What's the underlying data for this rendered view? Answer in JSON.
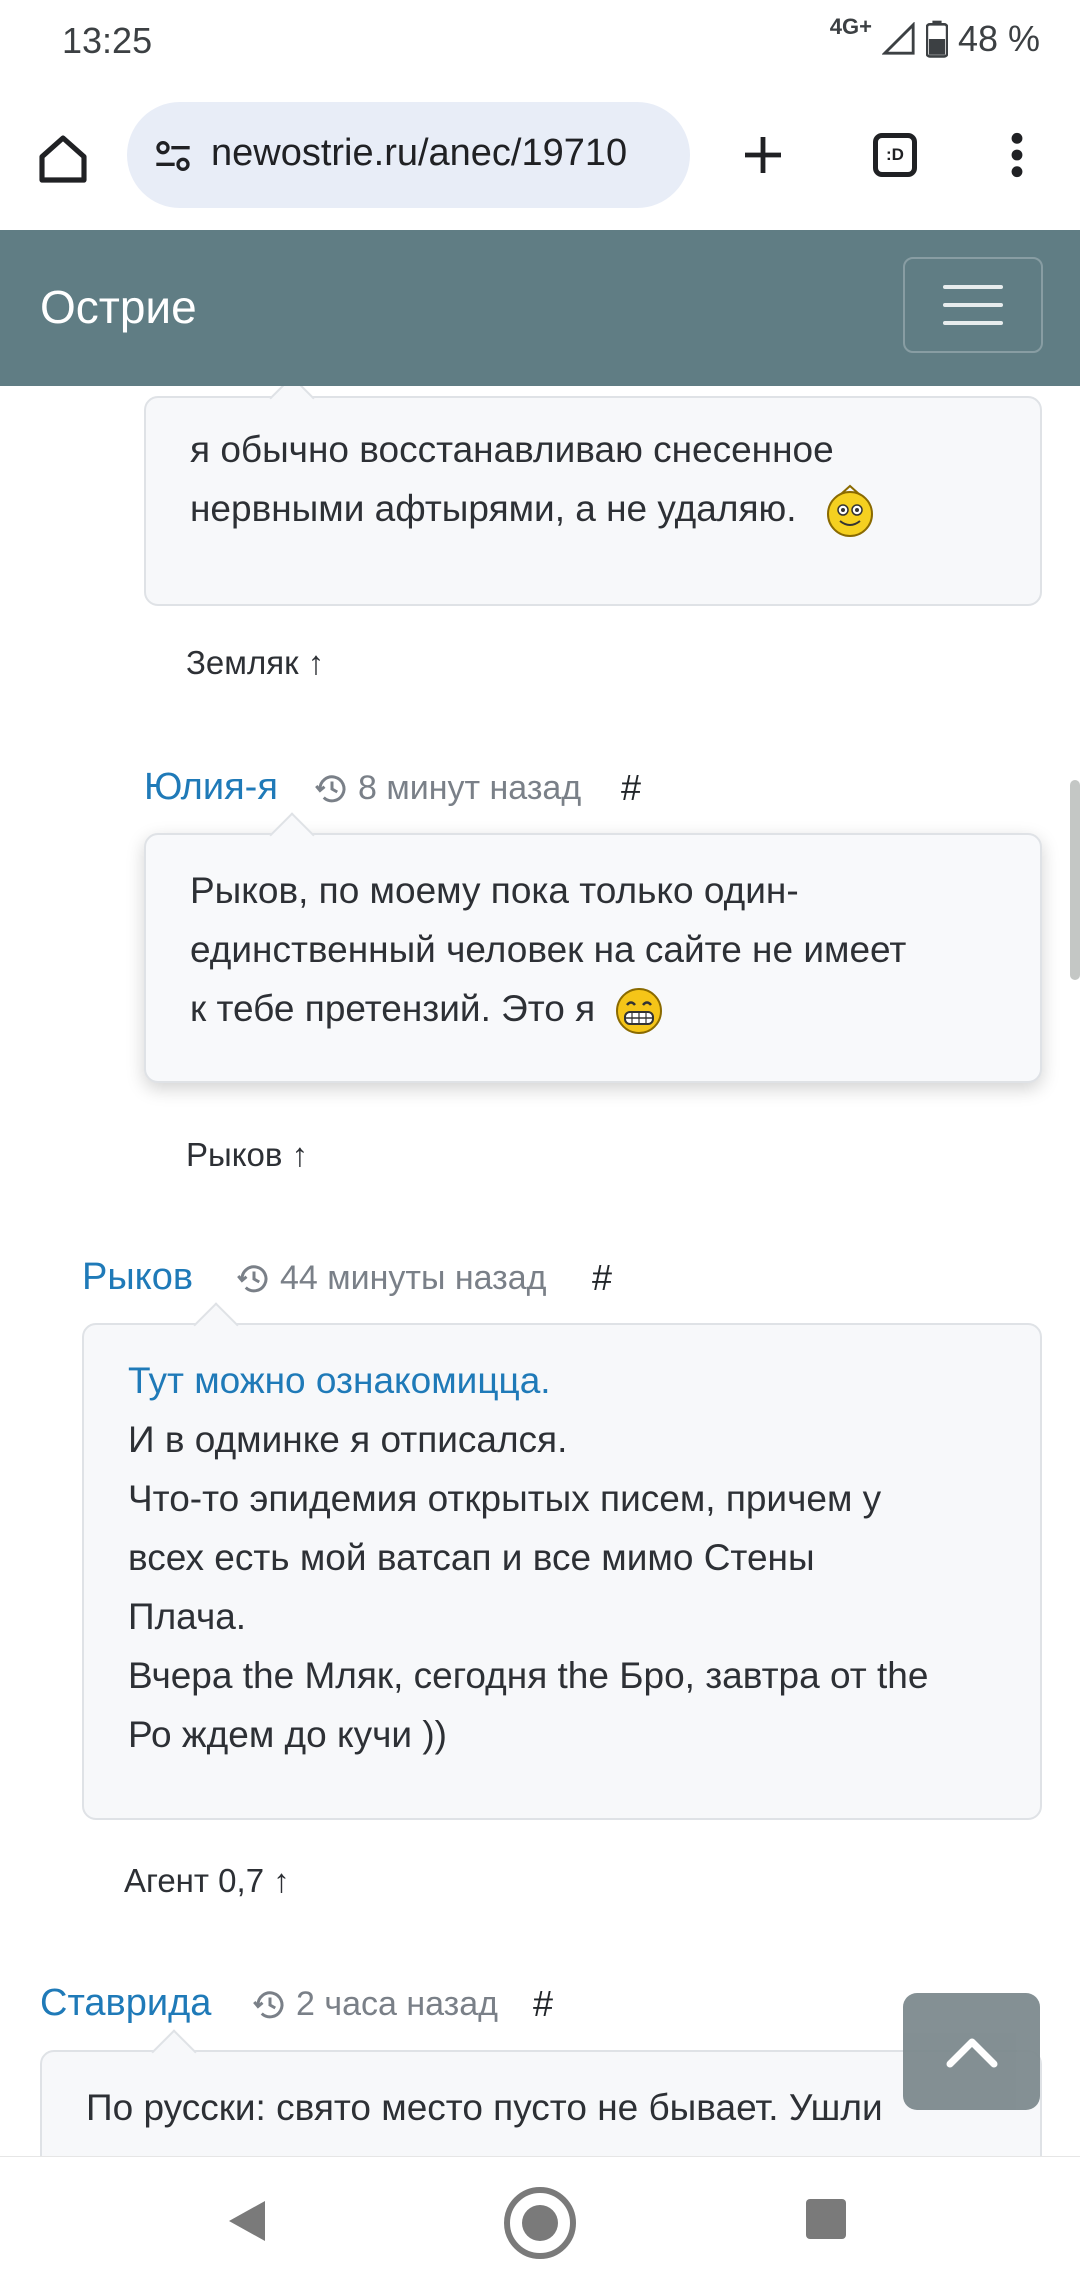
{
  "status": {
    "time": "13:25",
    "network": "4G+",
    "battery": "48 %"
  },
  "browser": {
    "url": "newostrie.ru/anec/19710",
    "tabs_count": ":D"
  },
  "site": {
    "brand": "Острие"
  },
  "comments": [
    {
      "lines": [
        "я обычно восстанавливаю снесенное",
        "нервными афтырями, а не удаляю."
      ],
      "emoji": "wink-smiley-icon",
      "reply": "Земляк ↑"
    },
    {
      "author": "Юлия-я",
      "time": "8 минут назад",
      "hash": "#",
      "lines": [
        "Рыков, по моему пока только один-",
        "единственный человек на сайте не имеет",
        "к тебе претензий. Это я"
      ],
      "emoji": "grin-smiley-icon",
      "reply": "Рыков ↑"
    },
    {
      "author": "Рыков",
      "time": "44 минуты назад",
      "hash": "#",
      "link": "Тут можно ознакомицца.",
      "lines": [
        "И в одминке я отписался.",
        "Что-то эпидемия открытых писем, причем у",
        "всех есть мой ватсап и все мимо Стены",
        "Плача.",
        "Вчера the Мляк, сегодня the Бро, завтра от the",
        "Ро ждем до кучи ))"
      ],
      "reply": "Агент 0,7 ↑"
    },
    {
      "author": "Ставрида",
      "time": "2 часа назад",
      "hash": "#",
      "lines": [
        "По русски: свято место пусто не бывает. Ушли"
      ]
    }
  ],
  "colors": {
    "navbar": "#607d84",
    "author": "#1f7ab8",
    "bubble_bg": "#f7f8fa"
  }
}
